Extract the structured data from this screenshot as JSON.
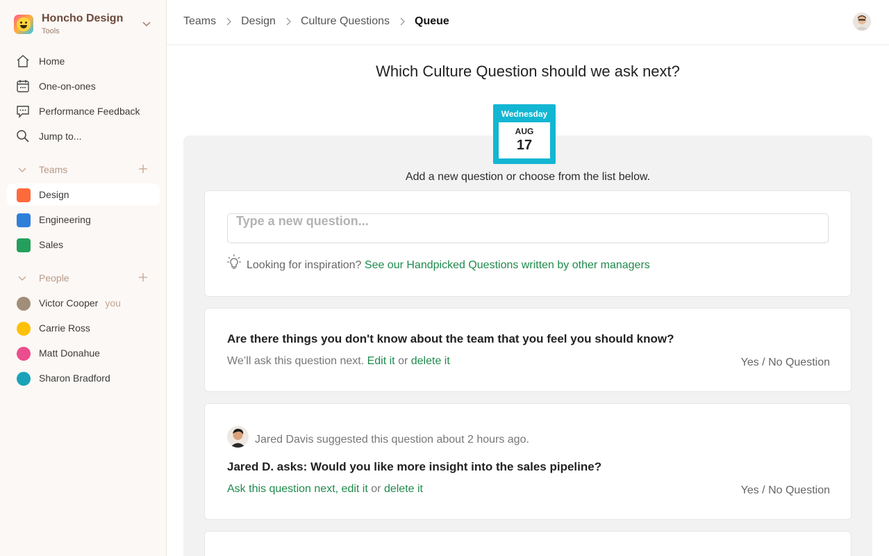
{
  "sidebar": {
    "workspace": {
      "name": "Honcho Design",
      "sub": "Tools"
    },
    "nav": [
      {
        "label": "Home",
        "icon": "home-icon"
      },
      {
        "label": "One-on-ones",
        "icon": "calendar-icon"
      },
      {
        "label": "Performance Feedback",
        "icon": "chat-bubble-icon"
      },
      {
        "label": "Jump to...",
        "icon": "search-icon"
      }
    ],
    "teams_label": "Teams",
    "teams": [
      {
        "label": "Design",
        "color": "#ff6a3d"
      },
      {
        "label": "Engineering",
        "color": "#2f7fd9"
      },
      {
        "label": "Sales",
        "color": "#23a05b"
      }
    ],
    "people_label": "People",
    "people": [
      {
        "label": "Victor Cooper",
        "tag": "you",
        "color": "#a08e78"
      },
      {
        "label": "Carrie Ross",
        "color": "#ffc107"
      },
      {
        "label": "Matt Donahue",
        "color": "#ec4d8c"
      },
      {
        "label": "Sharon Bradford",
        "color": "#1aa3b8"
      }
    ]
  },
  "breadcrumb": [
    "Teams",
    "Design",
    "Culture Questions",
    "Queue"
  ],
  "main": {
    "headline": "Which Culture Question should we ask next?",
    "calendar": {
      "weekday": "Wednesday",
      "month": "AUG",
      "day": "17"
    },
    "instruction": "Add a new question or choose from the list below.",
    "new_question": {
      "placeholder": "Type a new question...",
      "inspiration_text": "Looking for inspiration?",
      "inspiration_link": "See our Handpicked Questions written by other managers"
    },
    "queued": {
      "title": "Are there things you don't know about the team that you feel you should know?",
      "meta_prefix": "We’ll ask this question next.",
      "edit": "Edit it",
      "or": "or",
      "delete": "delete it",
      "type": "Yes / No Question"
    },
    "suggested": {
      "suggestion": "Jared Davis suggested this question about 2 hours ago.",
      "title": "Jared D. asks: Would you like more insight into the sales pipeline?",
      "ask_next": "Ask this question next,",
      "edit": "edit it",
      "or": "or",
      "delete": "delete it",
      "type": "Yes / No Question"
    }
  }
}
